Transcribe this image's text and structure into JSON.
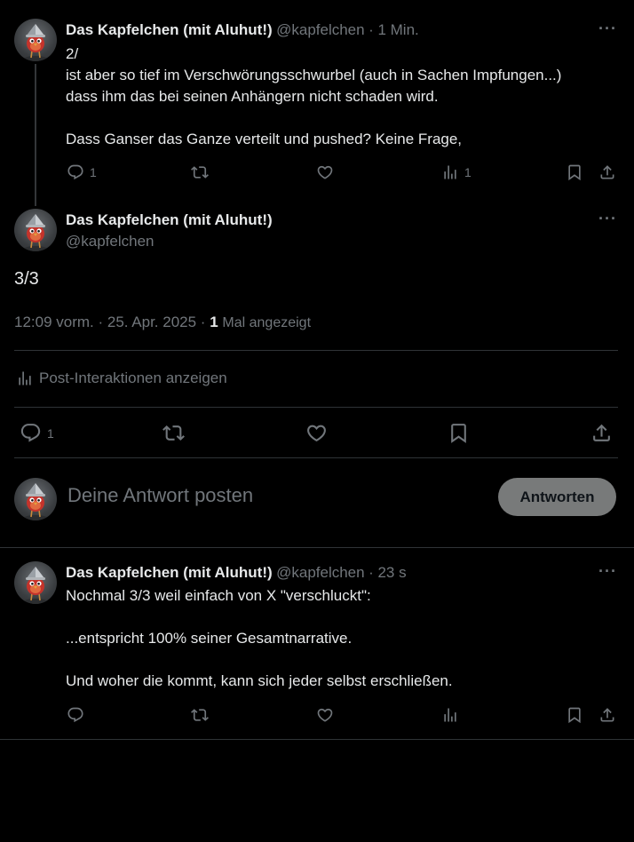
{
  "tweet1": {
    "name": "Das Kapfelchen (mit Aluhut!)",
    "handle": "@kapfelchen",
    "time": "· 1 Min.",
    "more": "···",
    "text": "2/\nist aber so tief im Verschwörungsschwurbel (auch in Sachen Impfungen...)\ndass ihm das bei seinen Anhängern nicht schaden wird.\n\nDass Ganser das Ganze verteilt und pushed? Keine Frage,",
    "reply_count": "1",
    "views_count": "1"
  },
  "main": {
    "name": "Das Kapfelchen (mit Aluhut!)",
    "handle": "@kapfelchen",
    "more": "···",
    "text": "3/3",
    "timestamp": "12:09 vorm. · 25. Apr. 2025 ·",
    "views_number": "1",
    "views_label": "Mal angezeigt",
    "interactions_label": "Post-Interaktionen anzeigen",
    "reply_count": "1"
  },
  "composer": {
    "placeholder": "Deine Antwort posten",
    "button": "Antworten"
  },
  "tweet3": {
    "name": "Das Kapfelchen (mit Aluhut!)",
    "handle": "@kapfelchen",
    "time": "· 23 s",
    "more": "···",
    "text": "Nochmal 3/3 weil einfach von X \"verschluckt\":\n\n...entspricht 100% seiner Gesamtnarrative.\n\nUnd woher die kommt, kann sich jeder selbst erschließen."
  },
  "icons": {
    "reply": "reply-icon",
    "repost": "repost-icon",
    "like": "like-icon",
    "views": "views-icon",
    "bookmark": "bookmark-icon",
    "share": "share-icon",
    "more": "more-icon"
  },
  "colors": {
    "background": "#000000",
    "text": "#e7e9ea",
    "muted": "#71767b",
    "divider": "#2f3336",
    "reply_button": "#787a7a"
  }
}
